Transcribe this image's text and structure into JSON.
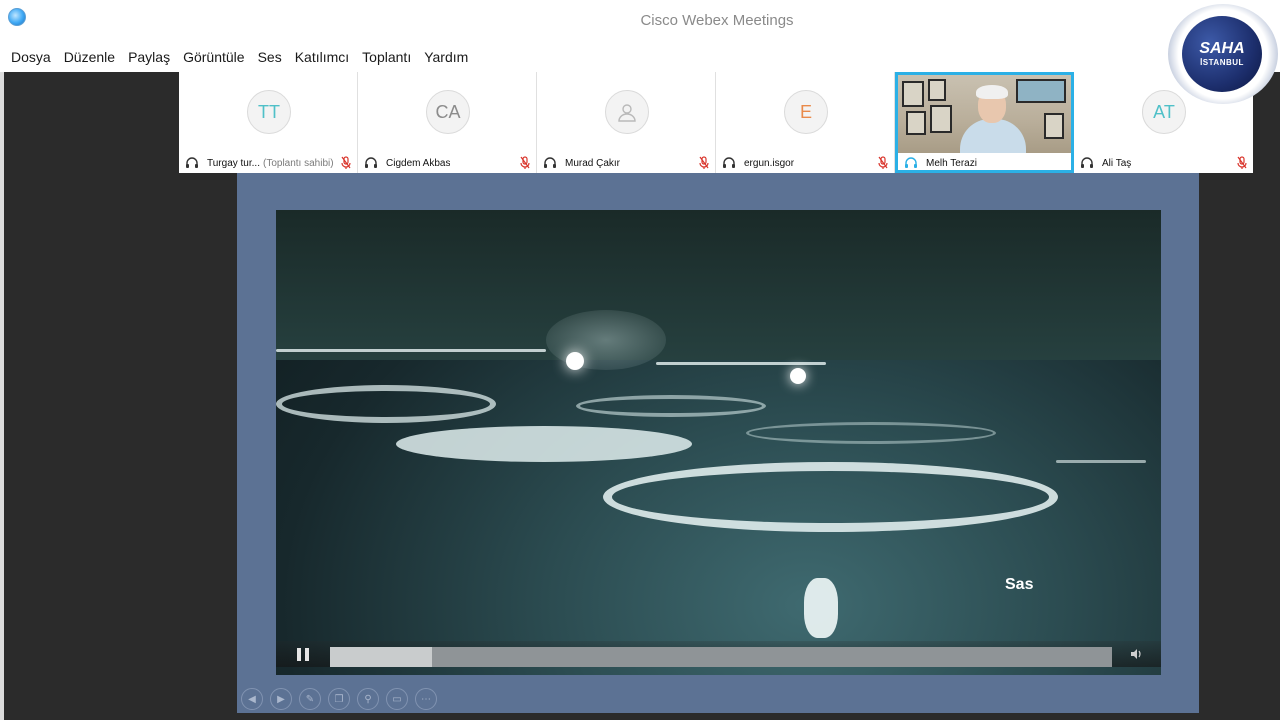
{
  "window": {
    "title": "Cisco Webex Meetings"
  },
  "menu": [
    "Dosya",
    "Düzenle",
    "Paylaş",
    "Görüntüle",
    "Ses",
    "Katılımcı",
    "Toplantı",
    "Yardım"
  ],
  "participants": [
    {
      "initials": "TT",
      "name": "Turgay tur...",
      "tag": "(Toplantı sahibi)",
      "muted": true,
      "color": "teal"
    },
    {
      "initials": "CA",
      "name": "Cigdem Akbas",
      "tag": "",
      "muted": true,
      "color": "gray"
    },
    {
      "initials": "",
      "name": "Murad Çakır",
      "tag": "",
      "muted": true,
      "color": "gray",
      "icon": "user-icon"
    },
    {
      "initials": "E",
      "name": "ergun.isgor",
      "tag": "",
      "muted": true,
      "color": "orange"
    },
    {
      "initials": "",
      "name": "Melh Terazi",
      "tag": "",
      "muted": false,
      "active": true,
      "video": true
    },
    {
      "initials": "AT",
      "name": "Ali Taş",
      "tag": "",
      "muted": true,
      "color": "teal"
    }
  ],
  "logo": {
    "text": "SAHA",
    "sub": "İSTANBUL"
  },
  "video": {
    "caption": "Sas",
    "progress": 0.13
  },
  "colors": {
    "active_border": "#2bb0e6",
    "mute_red": "#d9342b",
    "share_bg": "#5c7294"
  }
}
